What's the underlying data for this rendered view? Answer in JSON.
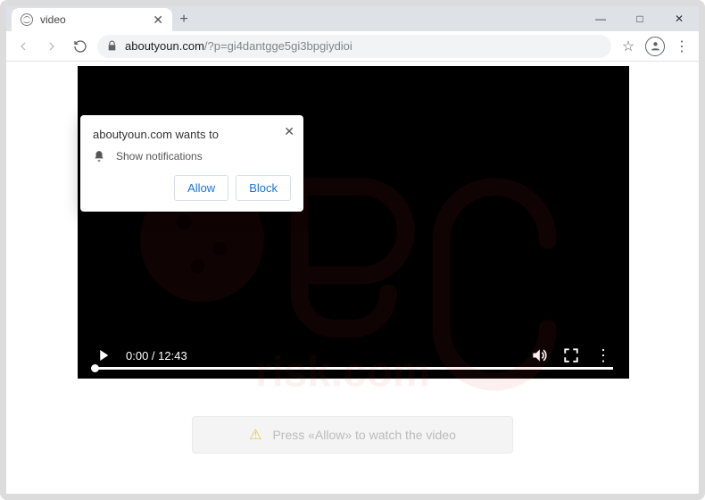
{
  "window": {
    "tab_title": "video",
    "minimize": "—",
    "maximize": "□",
    "close": "✕",
    "newtab": "+"
  },
  "addressbar": {
    "url_host": "aboutyoun.com",
    "url_path": "/?p=gi4dantgge5gi3bpgiydioi",
    "star_tip": "☆",
    "menu": "⋮"
  },
  "notification": {
    "title": "aboutyoun.com wants to",
    "body": "Show notifications",
    "allow": "Allow",
    "block": "Block",
    "close": "✕"
  },
  "video": {
    "time_current": "0:00",
    "time_sep": " / ",
    "time_total": "12:43"
  },
  "page_prompt": {
    "text": "Press «Allow» to watch the video"
  }
}
